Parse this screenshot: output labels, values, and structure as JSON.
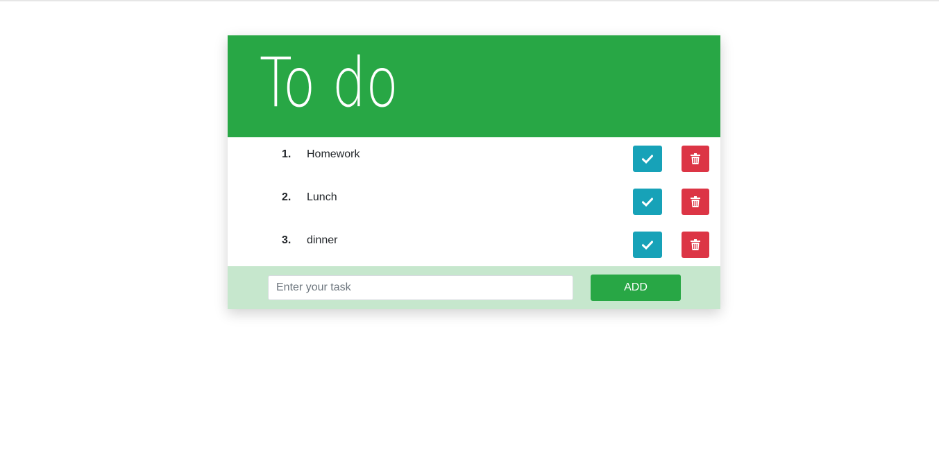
{
  "app": {
    "title": "To do"
  },
  "tasks": [
    {
      "number": "1.",
      "text": "Homework"
    },
    {
      "number": "2.",
      "text": "Lunch"
    },
    {
      "number": "3.",
      "text": "dinner"
    }
  ],
  "icons": {
    "done": "check-icon",
    "delete": "trash-icon"
  },
  "form": {
    "placeholder": "Enter your task",
    "value": "",
    "add_label": "ADD"
  },
  "colors": {
    "header": "#28a745",
    "done_button": "#17a2b8",
    "delete_button": "#dc3545",
    "footer": "#c6e7cd",
    "add_button": "#28a745"
  }
}
